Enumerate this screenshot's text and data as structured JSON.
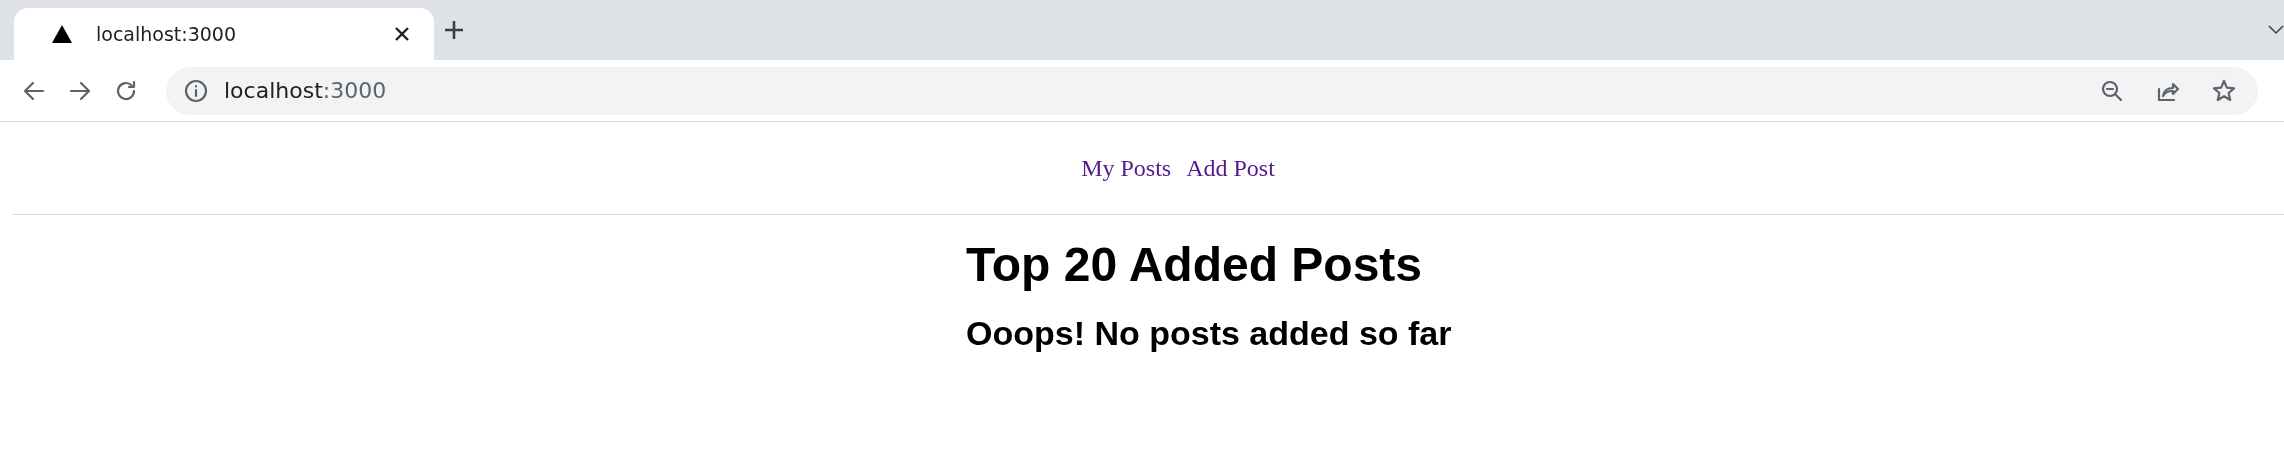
{
  "browser": {
    "tabs": [
      {
        "title": "localhost:3000",
        "selected": true
      }
    ],
    "address": {
      "host": "localhost",
      "port": ":3000"
    }
  },
  "nav": {
    "links": [
      {
        "label": "My Posts"
      },
      {
        "label": "Add Post"
      }
    ]
  },
  "main": {
    "title": "Top 20 Added Posts",
    "message": "Ooops! No posts added so far"
  }
}
